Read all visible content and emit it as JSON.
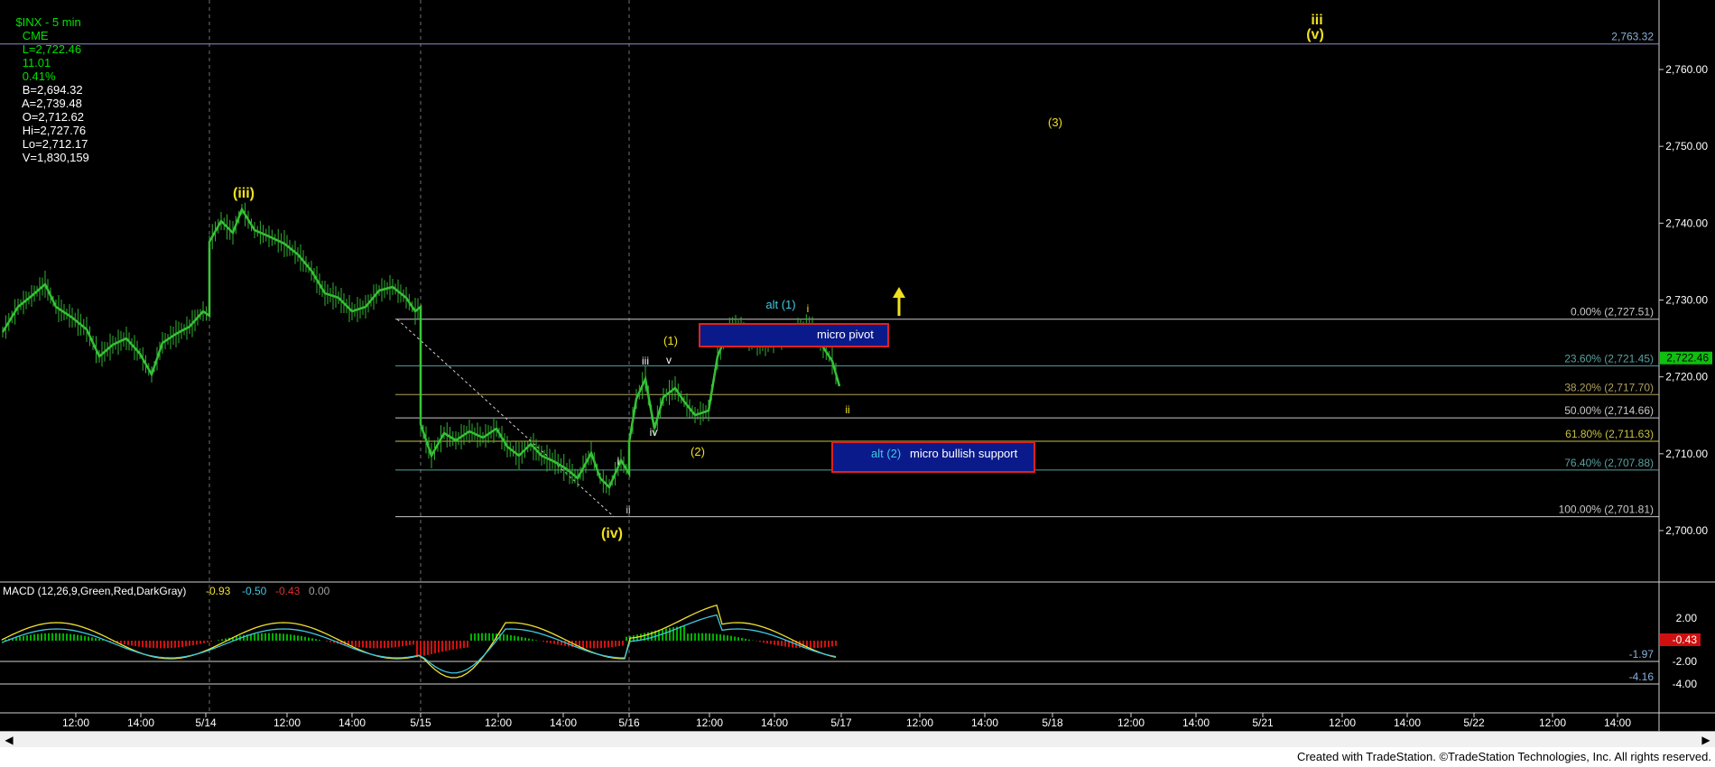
{
  "header": {
    "symbol": "$INX - 5 min",
    "exchange": "CME",
    "last": "L=2,722.46",
    "change": "11.01",
    "change_pct": "0.41%",
    "bid": "B=2,694.32",
    "ask": "A=2,739.48",
    "open": "O=2,712.62",
    "high": "Hi=2,727.76",
    "low": "Lo=2,712.17",
    "volume": "V=1,830,159"
  },
  "macd": {
    "title": "MACD (12,26,9,Green,Red,DarkGray)",
    "v1": "-0.93",
    "v2": "-0.50",
    "v3": "-0.43",
    "v4": "0.00",
    "axis_labels": [
      "2.00",
      "-2.00",
      "-4.00"
    ],
    "marker_labels": [
      "-1.97",
      "-4.16"
    ],
    "current_tag": "-0.43",
    "colors": {
      "macd": "#f0e030",
      "signal": "#40c8e0",
      "hist_pos": "#00b000",
      "hist_neg": "#d01010"
    }
  },
  "price_axis": {
    "ticks": [
      "2,760.00",
      "2,750.00",
      "2,740.00",
      "2,730.00",
      "2,720.00",
      "2,710.00",
      "2,700.00"
    ],
    "current": "2,722.46",
    "top_level": "2,763.32"
  },
  "fib_levels": [
    {
      "label": "0.00% (2,727.51)",
      "price": 2727.51,
      "color": "#c8c8c8"
    },
    {
      "label": "23.60% (2,721.45)",
      "price": 2721.45,
      "color": "#5aa0a0"
    },
    {
      "label": "38.20% (2,717.70)",
      "price": 2717.7,
      "color": "#b0a060"
    },
    {
      "label": "50.00% (2,714.66)",
      "price": 2714.66,
      "color": "#c8c8c8"
    },
    {
      "label": "61.80% (2,711.63)",
      "price": 2711.63,
      "color": "#c8c040"
    },
    {
      "label": "76.40% (2,707.88)",
      "price": 2707.88,
      "color": "#5aa0a0"
    },
    {
      "label": "100.00% (2,701.81)",
      "price": 2701.81,
      "color": "#c8c8c8"
    }
  ],
  "boxes": {
    "micro_pivot": "micro pivot",
    "alt2_prefix": "alt (2)",
    "alt2_text": "micro bullish support"
  },
  "wave_labels": {
    "iii_intermediate": "(iii)",
    "iv_intermediate": "(iv)",
    "v_intermediate": "(v)",
    "iii_top": "iii",
    "three": "(3)",
    "one": "(1)",
    "two": "(2)",
    "alt1": "alt (1)",
    "i_a": "i",
    "ii_a": "ii",
    "i_b": "i",
    "ii_b": "ii",
    "iii_c": "iii",
    "iv_c": "iv",
    "v_c": "v"
  },
  "time_axis": [
    "12:00",
    "14:00",
    "5/14",
    "12:00",
    "14:00",
    "5/15",
    "12:00",
    "14:00",
    "5/16",
    "12:00",
    "14:00",
    "5/17",
    "12:00",
    "14:00",
    "5/18",
    "12:00",
    "14:00",
    "5/21",
    "12:00",
    "14:00",
    "5/22",
    "12:00",
    "14:00"
  ],
  "footer": "Created with TradeStation. ©TradeStation Technologies, Inc. All rights reserved.",
  "chart_data": {
    "type": "line",
    "description_series": "5-minute price bars (approximate close path)",
    "x": [
      "5/14 10:00",
      "5/14 11:00",
      "5/14 12:00",
      "5/14 13:00",
      "5/14 14:00",
      "5/14 15:00",
      "5/15 10:00",
      "5/15 11:00",
      "5/15 12:00",
      "5/15 13:00",
      "5/15 14:00",
      "5/15 15:00",
      "5/16 10:00",
      "5/16 11:00",
      "5/16 12:00",
      "5/16 13:00",
      "5/16 14:00",
      "5/16 15:00"
    ],
    "series": [
      {
        "name": "$INX",
        "values": [
          2728,
          2731,
          2724,
          2719,
          2725,
          2726,
          2737,
          2741,
          2738,
          2735,
          2729,
          2731,
          2711,
          2712,
          2709,
          2707,
          2706,
          2702
        ]
      }
    ],
    "ylim": [
      2694,
      2766
    ],
    "ylabel": ""
  }
}
